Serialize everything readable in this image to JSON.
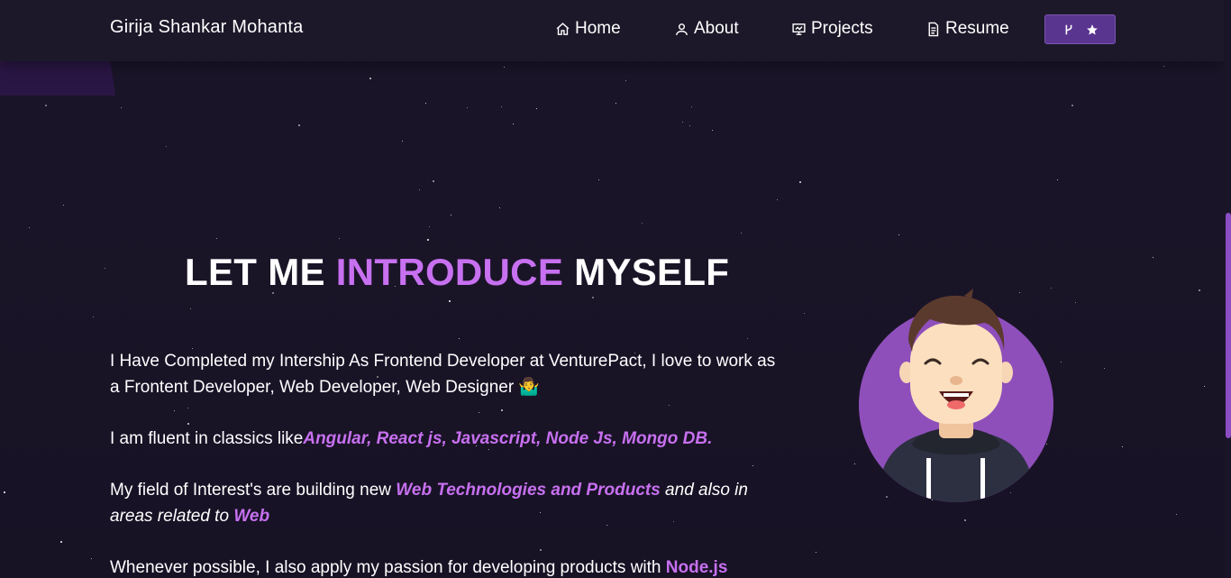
{
  "nav": {
    "brand": "Girija Shankar Mohanta",
    "items": [
      {
        "label": "Home",
        "icon": "home-icon"
      },
      {
        "label": "About",
        "icon": "user-icon"
      },
      {
        "label": "Projects",
        "icon": "projects-icon"
      },
      {
        "label": "Resume",
        "icon": "document-icon"
      }
    ],
    "fork_button": {
      "icons": [
        "git-fork-icon",
        "star-icon"
      ]
    }
  },
  "hero": {
    "heading_part1": "LET ME ",
    "heading_accent": "INTRODUCE",
    "heading_part2": " MYSELF"
  },
  "about": {
    "p1": "I Have Completed my Intership As Frontend Developer at VenturePact, I love to work as a Frontent Developer, Web Developer, Web Designer 🤷‍♂️",
    "p2_prefix": "I am fluent in classics like",
    "p2_skills": "Angular, React js, Javascript, Node Js, Mongo DB.",
    "p3_prefix": "My field of Interest's are building new ",
    "p3_highlight1": "Web Technologies and Products",
    "p3_middle": " and also in areas related to ",
    "p3_highlight2": "Web",
    "p4_prefix": "Whenever possible, I also apply my passion for developing products with ",
    "p4_highlight": "Node.js"
  },
  "colors": {
    "accent": "#c770f0",
    "background": "#1a1428",
    "navbar": "#1c1829",
    "button": "#5a3590",
    "avatar_circle": "#8e4fbb"
  }
}
